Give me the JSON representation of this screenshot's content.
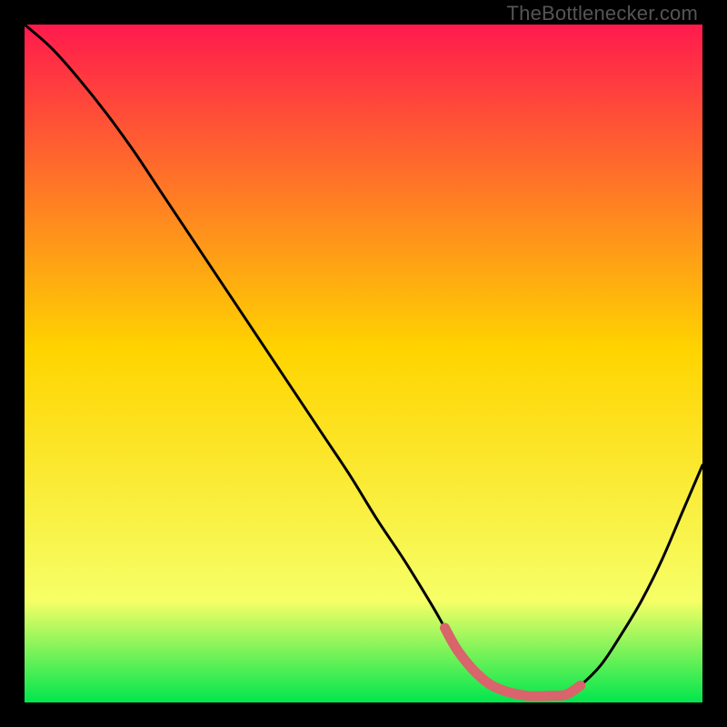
{
  "watermark": "TheBottlenecker.com",
  "chart_data": {
    "type": "line",
    "title": "",
    "xlabel": "",
    "ylabel": "",
    "xlim": [
      0,
      100
    ],
    "ylim": [
      0,
      100
    ],
    "grid": false,
    "gradient": {
      "top_color": "#ff1a4d",
      "mid_color": "#ffd400",
      "lower_color": "#f6ff66",
      "bottom_color": "#00e64d"
    },
    "series": [
      {
        "name": "bottleneck-curve",
        "color": "#000000",
        "x": [
          0,
          4,
          8,
          12,
          16,
          20,
          24,
          28,
          32,
          36,
          40,
          44,
          48,
          52,
          56,
          60,
          62,
          64,
          67,
          70,
          74,
          78,
          80,
          82,
          85,
          88,
          91,
          94,
          97,
          100
        ],
        "y": [
          100,
          96.5,
          92,
          87,
          81.5,
          75.5,
          69.5,
          63.5,
          57.5,
          51.5,
          45.5,
          39.5,
          33.5,
          27,
          21,
          14.5,
          11,
          7.5,
          4,
          2,
          1,
          1,
          1.2,
          2.5,
          5.5,
          10,
          15,
          21,
          28,
          35
        ]
      },
      {
        "name": "highlight-band",
        "color": "#d9646b",
        "x": [
          62,
          64,
          67,
          70,
          74,
          78,
          80,
          82
        ],
        "y": [
          11,
          7.5,
          4,
          2,
          1,
          1,
          1.2,
          2.5
        ]
      }
    ]
  }
}
